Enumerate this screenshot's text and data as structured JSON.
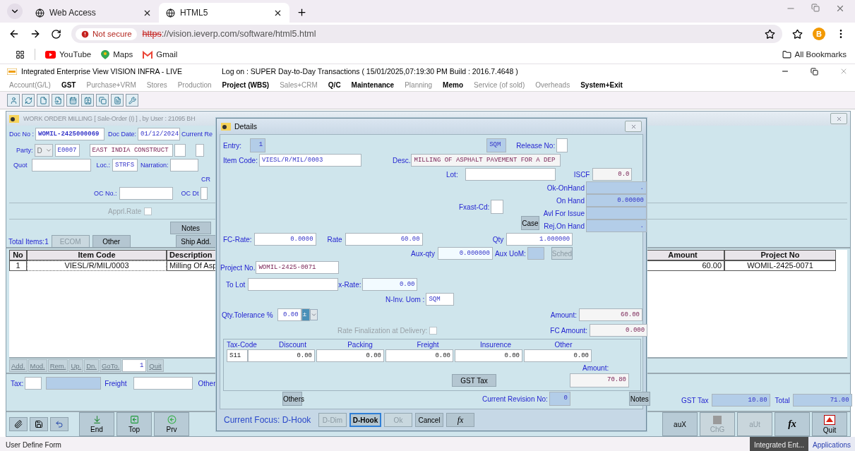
{
  "browser": {
    "tabs": [
      {
        "label": "Web Access",
        "selected": false
      },
      {
        "label": "HTML5",
        "selected": true
      }
    ],
    "security_label": "Not secure",
    "url_scheme": "https",
    "url_rest": "://vision.ieverp.com/software/html5.html",
    "profile_initial": "B",
    "bookmarks": [
      "YouTube",
      "Maps",
      "Gmail"
    ],
    "all_bookmarks": "All Bookmarks"
  },
  "app": {
    "title": "Integrated Enterprise View  VISION INFRA - LIVE",
    "session": "Log on : SUPER  Day-to-Day Transactions ( 15/01/2025,07:19:30 PM Build : 2016.7.4648 )",
    "menu": [
      {
        "label": "Account(G/L)",
        "disabled": true
      },
      {
        "label": "GST",
        "disabled": false
      },
      {
        "label": "Purchase+VRM",
        "disabled": true
      },
      {
        "label": "Stores",
        "disabled": true
      },
      {
        "label": "Production",
        "disabled": true
      },
      {
        "label": "Project (WBS)",
        "disabled": false
      },
      {
        "label": "Sales+CRM",
        "disabled": true
      },
      {
        "label": "Q/C",
        "disabled": false
      },
      {
        "label": "Maintenance",
        "disabled": false
      },
      {
        "label": "Planning",
        "disabled": true
      },
      {
        "label": "Memo",
        "disabled": false
      },
      {
        "label": "Service (of sold)",
        "disabled": true
      },
      {
        "label": "Overheads",
        "disabled": true
      },
      {
        "label": "System+Exit",
        "disabled": false
      }
    ]
  },
  "form": {
    "title": "WORK ORDER MILLING  [  Sale-Order     (I)  ] , by User : 21095  BH",
    "doc_no_label": "Doc No :",
    "doc_no": "WOMIL-2425000069",
    "doc_date_label": "Doc Date:",
    "doc_date": "01/12/2024",
    "current_label": "Current Re",
    "party_label": "Party:",
    "party_type": "D",
    "party_code": "E0007",
    "party_name": "EAST INDIA CONSTRUCT",
    "quot_label": "Quot",
    "loc_label": "Loc.:",
    "loc": "STRFS",
    "narration_label": "Narration:",
    "cr_label": "CR",
    "oc_no_label": "OC No.:",
    "oc_dt_label": "OC Dt",
    "apprl_rate": {
      "label": "Apprl.Rate",
      "checked": false
    },
    "notes_button": "Notes",
    "total_items": "Total Items:1",
    "buttons": [
      {
        "label": "ECOM",
        "disabled": true
      },
      {
        "label": "Other",
        "disabled": false
      }
    ],
    "ship_button": "Ship Add.",
    "grid": {
      "columns": [
        "No",
        "Item Code",
        "Description",
        "Amount",
        "Project No"
      ],
      "rows": [
        {
          "no": "1",
          "item_code": "VIESL/R/MIL/0003",
          "description": "Milling Of Asp",
          "amount": "60.00",
          "project_no": "WOMIL-2425-0071"
        }
      ]
    },
    "grid_tools": [
      "Add.",
      "Mod.",
      "Rem.",
      "Up.",
      "Dn.",
      "GoTo."
    ],
    "goto_value": "1",
    "grid_quit": "Quit",
    "tax_label": "Tax:",
    "freight_label": "Freight",
    "other_label": "Other",
    "gst_tax_label": "GST Tax",
    "gst_tax": "10.80",
    "total_label": "Total",
    "total": "71.00",
    "nav_buttons": [
      {
        "label": "End",
        "kind": "end"
      },
      {
        "label": "Top",
        "kind": "top"
      },
      {
        "label": "Prv",
        "kind": "prev"
      }
    ],
    "action_buttons": [
      {
        "label": "auX",
        "disabled": false,
        "kind": "text"
      },
      {
        "label": "ChG",
        "disabled": true,
        "kind": "square"
      },
      {
        "label": "aUt",
        "disabled": true,
        "kind": "text"
      },
      {
        "label": "fx",
        "disabled": false,
        "kind": "formula"
      },
      {
        "label": "Quit",
        "disabled": false,
        "kind": "quit"
      }
    ]
  },
  "dialog": {
    "title": "Details",
    "entry_label": "Entry:",
    "entry": "1",
    "uom": "SQM",
    "release_label": "Release No:",
    "item_code_label": "Item Code:",
    "item_code": "VIESL/R/MIL/0003",
    "desc_label": "Desc.",
    "desc": "MILLING OF ASPHALT PAVEMENT FOR A DEP",
    "lot_label": "Lot:",
    "iscf_label": "ISCF",
    "iscf": "0.0",
    "stock": [
      {
        "label": "Ok-OnHand",
        "value": "."
      },
      {
        "label": "On Hand",
        "value": "0.00000"
      },
      {
        "label": "Avl For Issue"
      },
      {
        "label": "Rej.On Hand",
        "value": "."
      }
    ],
    "fxast_label": "Fxast-Cd:",
    "case_button": "Case",
    "fc_rate_label": "FC-Rate:",
    "fc_rate": "0.0000",
    "rate_label": "Rate",
    "rate": "60.00",
    "qty_label": "Qty",
    "qty": "1.000000",
    "aux_qty_label": "Aux-qty",
    "aux_qty": "0.000000",
    "aux_uom_label": "Aux UoM:",
    "sched_button": {
      "label": "Sched",
      "disabled": true
    },
    "project_label": "Project No.",
    "project_no": "WOMIL-2425-0071",
    "to_lot_label": "To Lot",
    "x_rate_label": "x-Rate:",
    "x_rate": "0.00",
    "ninv_label": "N-Inv. Uom :",
    "ninv_uom": "SQM",
    "tolerance_label": "Qty.Tolerance %",
    "tolerance": "0.00",
    "tolerance_sign": "±",
    "amount_label": "Amount:",
    "amount": "60.00",
    "rate_final": {
      "label": "Rate Finalization at Delivery:",
      "checked": false
    },
    "fc_amount_label": "FC Amount:",
    "fc_amount": "0.000",
    "tax_columns": [
      "Tax-Code",
      "Discount",
      "Packing",
      "Freight",
      "Insurence",
      "Other"
    ],
    "tax_values": [
      "S11",
      "0.00",
      "0.00",
      "0.00",
      "0.00",
      "0.00"
    ],
    "tax_amount_label": "Amount:",
    "gst_button": "GST Tax",
    "tax_amount": "70.80",
    "others_button": "Others",
    "revision_label": "Current Revision No:",
    "revision": "0",
    "notes_button": "Notes",
    "focus": "Current Focus: D-Hook",
    "buttons": [
      {
        "label": "D-Dim",
        "disabled": true,
        "focused": false,
        "kind": "text"
      },
      {
        "label": "D-Hook",
        "disabled": false,
        "focused": true,
        "kind": "text"
      },
      {
        "label": "Ok",
        "disabled": true,
        "focused": false,
        "kind": "text"
      },
      {
        "label": "Cancel",
        "disabled": false,
        "focused": false,
        "kind": "text"
      },
      {
        "label": "fx",
        "disabled": false,
        "focused": false,
        "kind": "formula"
      }
    ]
  },
  "status_bar": "User Define Form",
  "taskbar": [
    {
      "label": "Integrated Ent...",
      "selected": true
    },
    {
      "label": "Applications",
      "selected": false
    }
  ]
}
